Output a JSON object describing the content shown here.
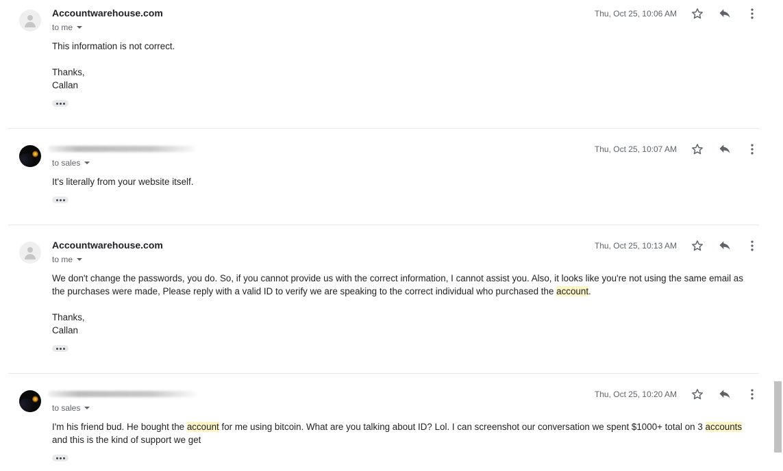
{
  "messages": [
    {
      "sender": "Accountwarehouse.com",
      "recipient": "to me",
      "date": "Thu, Oct 25, 10:06 AM",
      "body": [
        "This information is not correct.",
        "",
        "Thanks,",
        "Callan"
      ]
    },
    {
      "sender": "",
      "recipient": "to sales",
      "date": "Thu, Oct 25, 10:07 AM",
      "body": [
        "It's literally from your website itself."
      ]
    },
    {
      "sender": "Accountwarehouse.com",
      "recipient": "to me",
      "date": "Thu, Oct 25, 10:13 AM",
      "body_parts": {
        "p1_a": "We don't change the passwords, you do. So, if you cannot provide us with the correct information, I cannot assist you. Also, it looks like you're not using the same email as the purchases were made, Please reply with a valid ID to verify we are speaking to the correct individual who purchased the ",
        "p1_hl": "account",
        "p1_b": ".",
        "p2": "Thanks,",
        "p3": "Callan"
      }
    },
    {
      "sender": "",
      "recipient": "to sales",
      "date": "Thu, Oct 25, 10:20 AM",
      "body_parts": {
        "a": "I'm his friend bud. He bought the ",
        "hl1": "account",
        "b": " for me using bitcoin. What are you talking about ID? Lol. I can screenshot our conversation we spent $1000+ total on 3 ",
        "hl2": "accounts",
        "c": " and this is the kind of support we get"
      }
    }
  ],
  "icons": {
    "star": "star-icon",
    "reply": "reply-icon",
    "more": "more-vertical-icon",
    "expand": "show-trimmed-content-icon"
  },
  "colors": {
    "highlight": "#fdf6c8",
    "text": "#222222",
    "secondary": "#5f6368"
  }
}
